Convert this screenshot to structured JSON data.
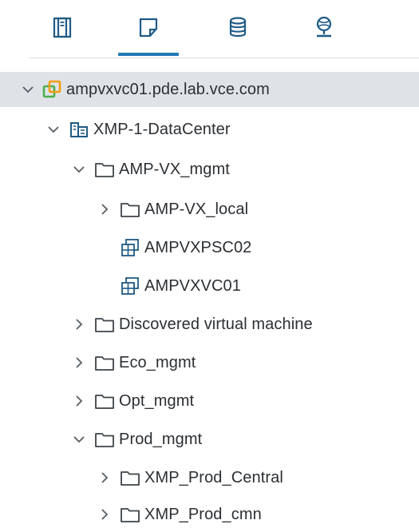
{
  "tabs": [
    {
      "icon": "hosts-and-clusters-icon",
      "active": false
    },
    {
      "icon": "vms-and-templates-icon",
      "active": true
    },
    {
      "icon": "storage-icon",
      "active": false
    },
    {
      "icon": "networking-icon",
      "active": false
    }
  ],
  "colors": {
    "accent": "#1f78b4",
    "selected_row": "#dfe3e7",
    "vcenter_green": "#4caf50",
    "vcenter_orange": "#f39c12",
    "icon_blue": "#1f5a85"
  },
  "tree": {
    "vcenter": {
      "label": "ampvxvc01.pde.lab.vce.com",
      "expanded": true,
      "selected": true
    },
    "datacenter": {
      "label": "XMP-1-DataCenter",
      "expanded": true
    },
    "amp_vx_mgmt": {
      "label": "AMP-VX_mgmt",
      "expanded": true
    },
    "amp_vx_local": {
      "label": "AMP-VX_local",
      "expanded": false
    },
    "ampvxpsc02": {
      "label": "AMPVXPSC02"
    },
    "ampvxvc01": {
      "label": "AMPVXVC01"
    },
    "discovered": {
      "label": "Discovered virtual machine",
      "expanded": false
    },
    "eco_mgmt": {
      "label": "Eco_mgmt",
      "expanded": false
    },
    "opt_mgmt": {
      "label": "Opt_mgmt",
      "expanded": false
    },
    "prod_mgmt": {
      "label": "Prod_mgmt",
      "expanded": true
    },
    "xmp_prod_central": {
      "label": "XMP_Prod_Central",
      "expanded": false
    },
    "xmp_prod_cmn": {
      "label": "XMP_Prod_cmn",
      "expanded": false
    }
  }
}
